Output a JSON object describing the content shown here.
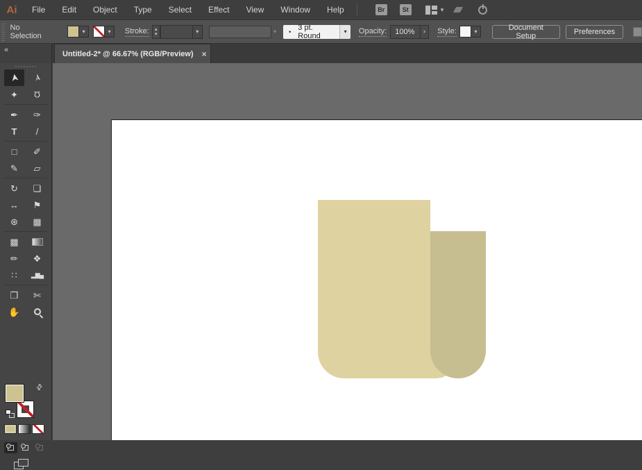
{
  "app": {
    "logo": "Ai",
    "logo_color": "#b4663d"
  },
  "menu_bar": {
    "items": [
      {
        "label": "File"
      },
      {
        "label": "Edit"
      },
      {
        "label": "Object"
      },
      {
        "label": "Type"
      },
      {
        "label": "Select"
      },
      {
        "label": "Effect"
      },
      {
        "label": "View"
      },
      {
        "label": "Window"
      },
      {
        "label": "Help"
      }
    ],
    "bridge_label": "Br",
    "stock_label": "St"
  },
  "control_bar": {
    "selection_status": "No Selection",
    "fill_color": "#cec390",
    "stroke_swatch": "none",
    "stroke_label": "Stroke:",
    "brush_bullet": "•",
    "brush_value": "3 pt. Round",
    "opacity_label": "Opacity:",
    "opacity_value": "100%",
    "opacity_arrow": "›",
    "style_label": "Style:",
    "document_setup_label": "Document Setup",
    "preferences_label": "Preferences"
  },
  "icons": {
    "chevron_down": "▾",
    "caret_up": "▴",
    "caret_down": "▾",
    "collapse": "«",
    "swap": "⇄",
    "close": "×"
  },
  "document_tab": {
    "title": "Untitled-2* @ 66.67% (RGB/Preview)"
  },
  "toolbar": {
    "selected_tool": "selection-tool",
    "tools": [
      {
        "name": "selection-tool",
        "glyph": "➤"
      },
      {
        "name": "direct-selection-tool",
        "glyph": "➢"
      },
      {
        "name": "magic-wand-tool",
        "glyph": "✦"
      },
      {
        "name": "lasso-tool",
        "glyph": "Ω"
      },
      {
        "name": "pen-tool",
        "glyph": "✒"
      },
      {
        "name": "curvature-tool",
        "glyph": "✑"
      },
      {
        "name": "type-tool",
        "glyph": "T"
      },
      {
        "name": "line-segment-tool",
        "glyph": "/"
      },
      {
        "name": "rectangle-tool",
        "glyph": "□"
      },
      {
        "name": "paintbrush-tool",
        "glyph": "✐"
      },
      {
        "name": "shaper-tool",
        "glyph": "✎"
      },
      {
        "name": "eraser-tool",
        "glyph": "▱"
      },
      {
        "name": "rotate-tool",
        "glyph": "↻"
      },
      {
        "name": "scale-tool",
        "glyph": "❏"
      },
      {
        "name": "width-tool",
        "glyph": "↔"
      },
      {
        "name": "puppet-warp-tool",
        "glyph": "⚑"
      },
      {
        "name": "shape-builder-tool",
        "glyph": "⊛"
      },
      {
        "name": "perspective-grid-tool",
        "glyph": "▦"
      },
      {
        "name": "mesh-tool",
        "glyph": "▩"
      },
      {
        "name": "gradient-tool",
        "glyph": ""
      },
      {
        "name": "eyedropper-tool",
        "glyph": "✏"
      },
      {
        "name": "blend-tool",
        "glyph": "❖"
      },
      {
        "name": "symbol-sprayer-tool",
        "glyph": "∷"
      },
      {
        "name": "column-graph-tool",
        "glyph": "▂▆▄"
      },
      {
        "name": "artboard-tool",
        "glyph": "❒"
      },
      {
        "name": "slice-tool",
        "glyph": "✄"
      },
      {
        "name": "hand-tool",
        "glyph": "✋"
      },
      {
        "name": "zoom-tool",
        "glyph": ""
      }
    ],
    "fill_color": "#cec390",
    "stroke": "none"
  },
  "canvas": {
    "pasteboard_color": "#6a6a6a",
    "artboard_color": "#ffffff",
    "shapes": {
      "front_fill": "#ded3a0",
      "back_fill": "#c6bd90"
    }
  }
}
